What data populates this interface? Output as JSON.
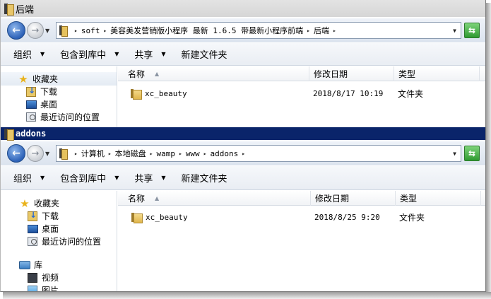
{
  "window1": {
    "title": "后端",
    "breadcrumbs": [
      "soft",
      "美容美发营销版小程序 最新 1.6.5 带最新小程序前端",
      "后端"
    ],
    "toolbar": {
      "organize": "组织",
      "include_library": "包含到库中",
      "share": "共享",
      "new_folder": "新建文件夹"
    },
    "nav": {
      "favorites": "收藏夹",
      "downloads": "下载",
      "desktop": "桌面",
      "recent": "最近访问的位置"
    },
    "columns": {
      "name": "名称",
      "date": "修改日期",
      "type": "类型"
    },
    "files": [
      {
        "name": "xc_beauty",
        "date": "2018/8/17 10:19",
        "type": "文件夹"
      }
    ]
  },
  "window2": {
    "title": "addons",
    "breadcrumbs": [
      "计算机",
      "本地磁盘",
      "wamp",
      "www",
      "addons"
    ],
    "toolbar": {
      "organize": "组织",
      "include_library": "包含到库中",
      "share": "共享",
      "new_folder": "新建文件夹"
    },
    "nav": {
      "favorites": "收藏夹",
      "downloads": "下载",
      "desktop": "桌面",
      "recent": "最近访问的位置",
      "libraries": "库",
      "videos": "视频",
      "pictures": "图片"
    },
    "columns": {
      "name": "名称",
      "date": "修改日期",
      "type": "类型"
    },
    "files": [
      {
        "name": "xc_beauty",
        "date": "2018/8/25 9:20",
        "type": "文件夹"
      }
    ]
  },
  "colors": {
    "active_title": "#0a246a",
    "inactive_title": "#d9d9d9",
    "address_bg": "#dbe3ee"
  }
}
